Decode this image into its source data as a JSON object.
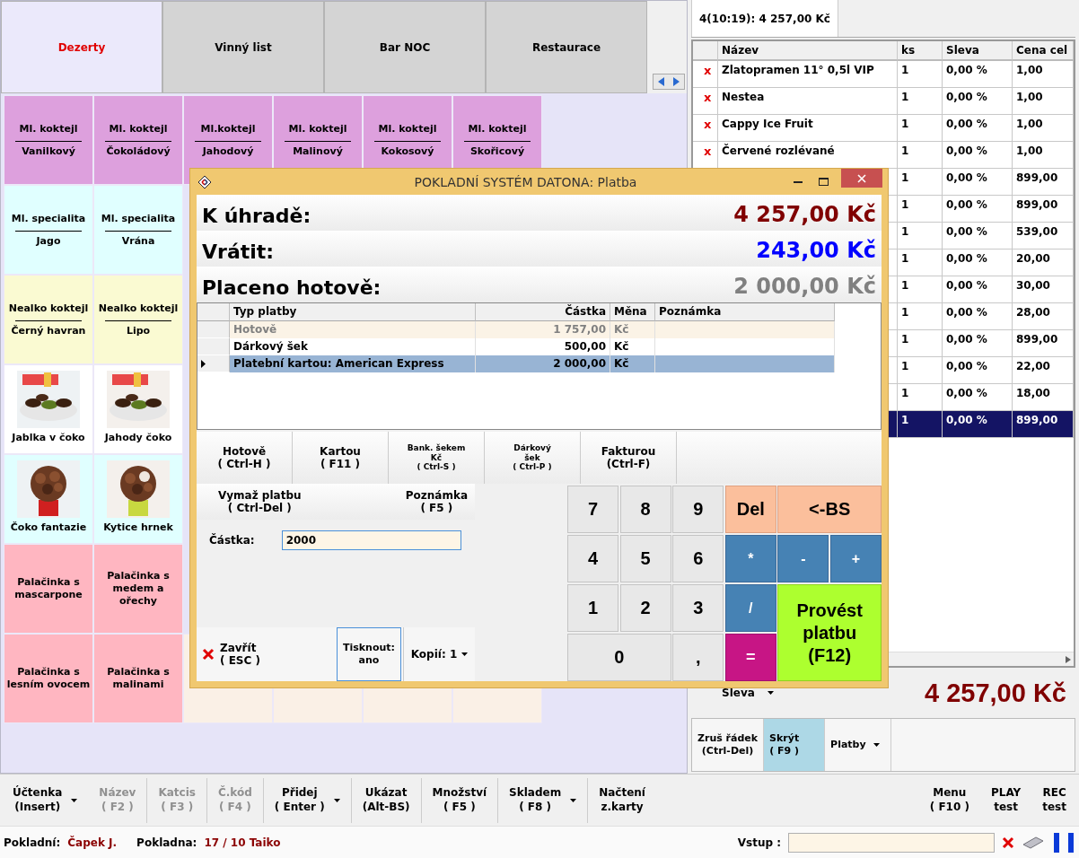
{
  "category_tabs": [
    {
      "label": "Dezerty",
      "selected": true
    },
    {
      "label": "Vinný list",
      "selected": false
    },
    {
      "label": "Bar NOC",
      "selected": false
    },
    {
      "label": "Restaurace",
      "selected": false
    }
  ],
  "products": [
    [
      {
        "kind": "split",
        "title": "Ml. koktejl",
        "subtitle": "Vanilkový",
        "color": "#dda0dd"
      },
      {
        "kind": "split",
        "title": "Ml. koktejl",
        "subtitle": "Čokoládový",
        "color": "#dda0dd"
      },
      {
        "kind": "split",
        "title": "Ml.koktejl",
        "subtitle": "Jahodový",
        "color": "#dda0dd"
      },
      {
        "kind": "split",
        "title": "Ml. koktejl",
        "subtitle": "Malinový",
        "color": "#dda0dd"
      },
      {
        "kind": "split",
        "title": "Ml. koktejl",
        "subtitle": "Kokosový",
        "color": "#dda0dd"
      },
      {
        "kind": "split",
        "title": "Ml. koktejl",
        "subtitle": "Skořicový",
        "color": "#dda0dd"
      }
    ],
    [
      {
        "kind": "split",
        "title": "Ml. specialita",
        "subtitle": "Jago",
        "color": "#e0ffff"
      },
      {
        "kind": "split",
        "title": "Ml. specialita",
        "subtitle": "Vrána",
        "color": "#e0ffff"
      }
    ],
    [
      {
        "kind": "split",
        "title": "Nealko koktejl",
        "subtitle": "Černý havran",
        "color": "#fafad2"
      },
      {
        "kind": "split",
        "title": "Nealko koktejl",
        "subtitle": "Lipo",
        "color": "#fafad2"
      }
    ],
    [
      {
        "kind": "picture",
        "label": "Jablka v čoko",
        "color": "#ffffff"
      },
      {
        "kind": "picture",
        "label": "Jahody čoko",
        "color": "#ffffff"
      }
    ],
    [
      {
        "kind": "picture",
        "label": "Čoko fantazie",
        "color": "#e0ffff"
      },
      {
        "kind": "picture",
        "label": "Kytice hrnek",
        "color": "#e0ffff"
      }
    ],
    [
      {
        "kind": "text",
        "label": "Palačinka s mascarpone",
        "color": "#ffb6c1"
      },
      {
        "kind": "text",
        "label": "Palačinka s medem a ořechy",
        "color": "#ffb6c1"
      }
    ],
    [
      {
        "kind": "text",
        "label": "Palačinka s lesním ovocem",
        "color": "#ffb6c1"
      },
      {
        "kind": "text",
        "label": "Palačinka s malinami",
        "color": "#ffb6c1"
      },
      {
        "kind": "empty",
        "color": "#faf0e6"
      },
      {
        "kind": "empty",
        "color": "#faf0e6"
      },
      {
        "kind": "empty",
        "color": "#faf0e6"
      },
      {
        "kind": "empty",
        "color": "#faf0e6"
      }
    ]
  ],
  "order": {
    "tab": "4(10:19): 4 257,00 Kč",
    "columns": [
      "Název",
      "ks",
      "Sleva",
      "Cena cel"
    ],
    "rows": [
      {
        "mark": "x",
        "name": "Zlatopramen 11° 0,5l VIP",
        "qty": "1",
        "discount": "0,00 %",
        "price": "1,00",
        "selected": false
      },
      {
        "mark": "x",
        "name": "Nestea",
        "qty": "1",
        "discount": "0,00 %",
        "price": "1,00",
        "selected": false
      },
      {
        "mark": "x",
        "name": "Cappy Ice Fruit",
        "qty": "1",
        "discount": "0,00 %",
        "price": "1,00",
        "selected": false
      },
      {
        "mark": "x",
        "name": "Červené rozlévané",
        "qty": "1",
        "discount": "0,00 %",
        "price": "1,00",
        "selected": false
      },
      {
        "qty": "1",
        "discount": "0,00 %",
        "price": "899,00",
        "selected": false
      },
      {
        "qty": "1",
        "discount": "0,00 %",
        "price": "899,00",
        "selected": false
      },
      {
        "qty": "1",
        "discount": "0,00 %",
        "price": "539,00",
        "selected": false
      },
      {
        "qty": "1",
        "discount": "0,00 %",
        "price": "20,00",
        "selected": false
      },
      {
        "qty": "1",
        "discount": "0,00 %",
        "price": "30,00",
        "selected": false
      },
      {
        "qty": "1",
        "discount": "0,00 %",
        "price": "28,00",
        "selected": false
      },
      {
        "qty": "1",
        "discount": "0,00 %",
        "price": "899,00",
        "selected": false
      },
      {
        "qty": "1",
        "discount": "0,00 %",
        "price": "22,00",
        "selected": false
      },
      {
        "qty": "1",
        "discount": "0,00 %",
        "price": "18,00",
        "selected": false
      },
      {
        "qty": "1",
        "discount": "0,00 %",
        "price": "899,00",
        "selected": true
      }
    ],
    "discount_menu": "Sleva",
    "total": "4 257,00 Kč",
    "buttons": [
      {
        "label": "Zruš řádek",
        "shortcut": "(Ctrl-Del)",
        "selected": false,
        "dropdown": false
      },
      {
        "label": "Skrýt",
        "shortcut": "( F9 )",
        "selected": true,
        "dropdown": false
      },
      {
        "label": "Platby",
        "selected": false,
        "dropdown": true
      }
    ]
  },
  "payment_dialog": {
    "title": "POKLADNÍ SYSTÉM DATONA: Platba",
    "summary": [
      {
        "kind": "due",
        "label": "K úhradě:",
        "value": "4 257,00 Kč"
      },
      {
        "kind": "change",
        "label": "Vrátit:",
        "value": "243,00 Kč"
      },
      {
        "kind": "paid",
        "label": "Placeno hotově:",
        "value": "2 000,00 Kč"
      }
    ],
    "columns": [
      "Typ platby",
      "Částka",
      "Měna",
      "Poznámka"
    ],
    "payments": [
      {
        "type": "Hotově",
        "amount": "1 757,00",
        "currency": "Kč",
        "selected": false,
        "disabled": true
      },
      {
        "type": "Dárkový šek",
        "amount": "500,00",
        "currency": "Kč",
        "selected": false,
        "disabled": false
      },
      {
        "type": "Platební kartou: American Express",
        "amount": "2 000,00",
        "currency": "Kč",
        "selected": true,
        "disabled": false
      }
    ],
    "methods": [
      {
        "kind": "large",
        "lines": [
          "Hotově",
          "( Ctrl-H )"
        ]
      },
      {
        "kind": "large",
        "lines": [
          "Kartou",
          "( F11 )"
        ]
      },
      {
        "kind": "small",
        "lines": [
          "Bank. šekem",
          "Kč",
          "( Ctrl-S )"
        ]
      },
      {
        "kind": "small",
        "lines": [
          "Dárkový",
          "šek",
          "( Ctrl-P )"
        ]
      },
      {
        "kind": "large",
        "lines": [
          "Fakturou",
          "(Ctrl-F)"
        ]
      }
    ],
    "delete_button": {
      "label": "Vymaž platbu",
      "shortcut": "( Ctrl-Del )"
    },
    "note_button": {
      "label": "Poznámka",
      "shortcut": "( F5 )"
    },
    "amount_field": {
      "label": "Částka:",
      "value": "2000"
    },
    "close_button": {
      "label": "Zavřít",
      "shortcut": "( ESC )"
    },
    "print_toggle": {
      "label": "Tisknout:",
      "value": "ano"
    },
    "copies": "Kopií: 1",
    "keypad": [
      {
        "kind": "digit",
        "label": "7"
      },
      {
        "kind": "digit",
        "label": "8"
      },
      {
        "kind": "digit",
        "label": "9"
      },
      {
        "kind": "clear",
        "label": "Del"
      },
      {
        "kind": "backspace",
        "label": "<-BS"
      },
      {
        "kind": "digit",
        "label": "4"
      },
      {
        "kind": "digit",
        "label": "5"
      },
      {
        "kind": "digit",
        "label": "6"
      },
      {
        "kind": "op",
        "label": "*"
      },
      {
        "kind": "op",
        "label": "-"
      },
      {
        "kind": "op",
        "label": "+"
      },
      {
        "kind": "digit",
        "label": "1"
      },
      {
        "kind": "digit",
        "label": "2"
      },
      {
        "kind": "digit",
        "label": "3"
      },
      {
        "kind": "op",
        "label": "/"
      },
      {
        "kind": "wide_digit",
        "label": "0"
      },
      {
        "kind": "digit",
        "label": ","
      },
      {
        "kind": "equals",
        "label": "="
      },
      {
        "kind": "submit",
        "label": "Provést platbu (F12)"
      }
    ]
  },
  "toolbar_left": [
    {
      "label": "Účtenka",
      "shortcut": "(Insert)",
      "dropdown": true,
      "disabled": false
    },
    {
      "label": "Název",
      "shortcut": "( F2 )",
      "dropdown": false,
      "disabled": true
    },
    {
      "label": "Katcis",
      "shortcut": "( F3 )",
      "dropdown": false,
      "disabled": true
    },
    {
      "label": "Č.kód",
      "shortcut": "( F4 )",
      "dropdown": false,
      "disabled": true
    },
    {
      "label": "Přidej",
      "shortcut": "( Enter )",
      "dropdown": true,
      "disabled": false
    },
    {
      "label": "Ukázat",
      "shortcut": "(Alt-BS)",
      "dropdown": false,
      "disabled": false
    },
    {
      "label": "Množství",
      "shortcut": "( F5 )",
      "dropdown": false,
      "disabled": false
    },
    {
      "label": "Skladem",
      "shortcut": "( F8 )",
      "dropdown": true,
      "disabled": false
    },
    {
      "label": "Načtení",
      "shortcut": "z.karty",
      "dropdown": false,
      "disabled": false
    }
  ],
  "toolbar_right": [
    {
      "label": "Menu",
      "shortcut": "( F10 )",
      "dropdown": false,
      "disabled": false
    },
    {
      "label": "PLAY",
      "shortcut": "test",
      "dropdown": false,
      "disabled": false
    },
    {
      "label": "REC",
      "shortcut": "test",
      "dropdown": false,
      "disabled": false
    }
  ],
  "status_bar": {
    "cashier_label": "Pokladní:",
    "cashier": "Čapek J.",
    "register_label": "Pokladna:",
    "register": "17 / 10 Taiko",
    "input_label": "Vstup :"
  }
}
